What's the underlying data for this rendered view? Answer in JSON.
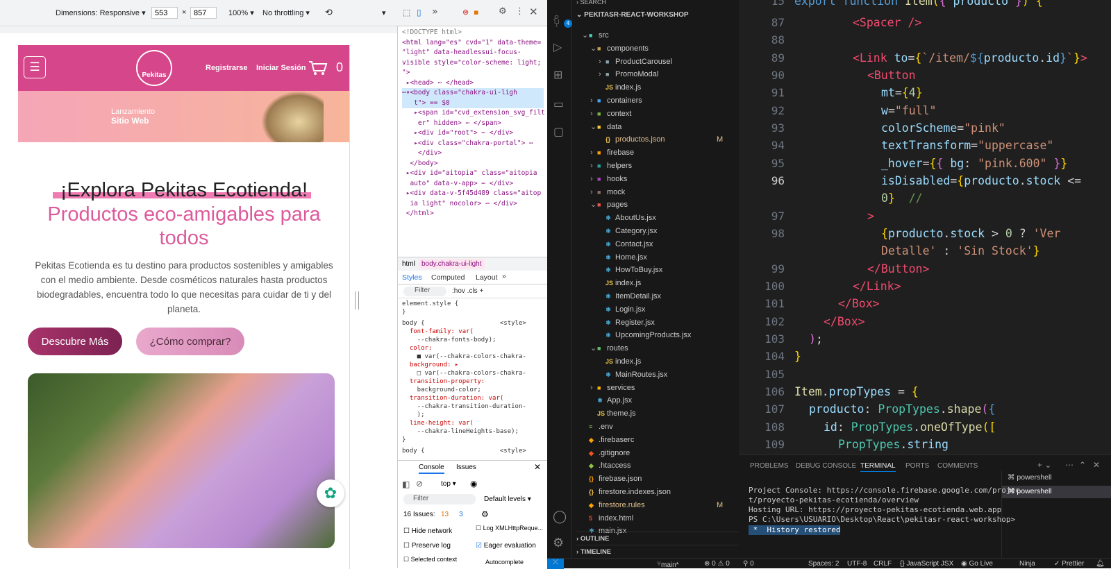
{
  "devtools_bar": {
    "dimensions_label": "Dimensions: Responsive ▾",
    "width": "553",
    "x": "×",
    "height": "857",
    "zoom": "100% ▾",
    "throttle": "No throttling ▾"
  },
  "site": {
    "nav": {
      "register": "Registrarse",
      "login": "Iniciar Sesión",
      "cart_count": "0",
      "logo_text": "Pekitas"
    },
    "banner": {
      "line1": "Lanzamiento",
      "line2": "Sitio Web"
    },
    "hero": {
      "title": "¡Explora Pekitas Ecotienda!",
      "subtitle": "Productos eco-amigables para todos",
      "description": "Pekitas Ecotienda es tu destino para productos sostenibles y amigables con el medio ambiente. Desde cosméticos naturales hasta productos biodegradables, encuentra todo lo que necesitas para cuidar de ti y del planeta.",
      "btn_primary": "Descubre Más",
      "btn_secondary": "¿Cómo comprar?"
    }
  },
  "devtools": {
    "dom_lines": [
      "<!DOCTYPE html>",
      "<html lang=\"es\" cvd=\"1\" data-theme=",
      "\"light\" data-headlessui-focus-",
      "visible style=\"color-scheme: light;",
      "\">",
      " ▸<head> ⋯ </head>",
      "⋯▾<body class=\"chakra-ui-ligh",
      "   t\"> == $0",
      "   ▸<span id=\"cvd_extension_svg_filt",
      "    er\" hidden> ⋯ </span>",
      "   ▸<div id=\"root\"> ⋯ </div>",
      "   ▸<div class=\"chakra-portal\"> ⋯ ",
      "    </div>",
      "  </body>",
      " ▸<div id=\"aitopia\" class=\"aitopia",
      "  auto\" data-v-app> ⋯ </div>",
      " ▸<div data-v-5f45d489 class=\"aitop",
      "  ia light\" nocolor> ⋯ </div>",
      " </html>"
    ],
    "crumbs": [
      "html",
      "body.chakra-ui-light"
    ],
    "style_tabs": [
      "Styles",
      "Computed",
      "Layout",
      "»"
    ],
    "filter_placeholder": "Filter",
    "filter_tools": ":hov  .cls  +",
    "style_lines": [
      "element.style {",
      "}",
      "body {                    <style>",
      "  font-family: var(",
      "    --chakra-fonts-body);",
      "  color:",
      "    ■ var(--chakra-colors-chakra-",
      "  background: ▸",
      "    □ var(--chakra-colors-chakra-",
      "  transition-property:",
      "    background-color;",
      "  transition-duration: var(",
      "    --chakra-transition-duration-",
      "    );",
      "  line-height: var(",
      "    --chakra-lineHeights-base);",
      "}",
      "body {                    <style>"
    ],
    "console": {
      "tabs": [
        "Console",
        "Issues"
      ],
      "context": "top ▾",
      "filter": "Filter",
      "levels": "Default levels ▾",
      "issues": "16 Issues:",
      "issues_warn": "13",
      "issues_info": "3",
      "opts": [
        "Hide network",
        "Log XMLHttpReque...",
        "Preserve log",
        "Eager evaluation",
        "Selected context",
        "Autocomplete"
      ]
    }
  },
  "vscode": {
    "search_header": "SEARCH",
    "project": "PEKITASR-REACT-WORKSHOP",
    "tree": [
      {
        "label": "src",
        "depth": 0,
        "type": "folder-open",
        "color": "#4ec9b0"
      },
      {
        "label": "components",
        "depth": 1,
        "type": "folder-open",
        "color": "#c5a24a"
      },
      {
        "label": "ProductCarousel",
        "depth": 2,
        "type": "folder",
        "color": "#90a4ae"
      },
      {
        "label": "PromoModal",
        "depth": 2,
        "type": "folder",
        "color": "#90a4ae"
      },
      {
        "label": "index.js",
        "depth": 2,
        "type": "js",
        "color": "#e8c547"
      },
      {
        "label": "containers",
        "depth": 1,
        "type": "folder",
        "color": "#42a5f5"
      },
      {
        "label": "context",
        "depth": 1,
        "type": "folder",
        "color": "#7cb342"
      },
      {
        "label": "data",
        "depth": 1,
        "type": "folder-open",
        "color": "#ffca28"
      },
      {
        "label": "productos.json",
        "depth": 2,
        "type": "json",
        "color": "#f5c451",
        "status": "M"
      },
      {
        "label": "firebase",
        "depth": 1,
        "type": "folder",
        "color": "#ffa000"
      },
      {
        "label": "helpers",
        "depth": 1,
        "type": "folder",
        "color": "#26a69a"
      },
      {
        "label": "hooks",
        "depth": 1,
        "type": "folder",
        "color": "#ab47bc"
      },
      {
        "label": "mock",
        "depth": 1,
        "type": "folder",
        "color": "#8d6e63"
      },
      {
        "label": "pages",
        "depth": 1,
        "type": "folder-open",
        "color": "#ef5350"
      },
      {
        "label": "AboutUs.jsx",
        "depth": 2,
        "type": "jsx",
        "color": "#4fc3f7"
      },
      {
        "label": "Category.jsx",
        "depth": 2,
        "type": "jsx",
        "color": "#4fc3f7"
      },
      {
        "label": "Contact.jsx",
        "depth": 2,
        "type": "jsx",
        "color": "#4fc3f7"
      },
      {
        "label": "Home.jsx",
        "depth": 2,
        "type": "jsx",
        "color": "#4fc3f7"
      },
      {
        "label": "HowToBuy.jsx",
        "depth": 2,
        "type": "jsx",
        "color": "#4fc3f7"
      },
      {
        "label": "index.js",
        "depth": 2,
        "type": "js",
        "color": "#e8c547"
      },
      {
        "label": "ItemDetail.jsx",
        "depth": 2,
        "type": "jsx",
        "color": "#4fc3f7"
      },
      {
        "label": "Login.jsx",
        "depth": 2,
        "type": "jsx",
        "color": "#4fc3f7"
      },
      {
        "label": "Register.jsx",
        "depth": 2,
        "type": "jsx",
        "color": "#4fc3f7"
      },
      {
        "label": "UpcomingProducts.jsx",
        "depth": 2,
        "type": "jsx",
        "color": "#4fc3f7"
      },
      {
        "label": "routes",
        "depth": 1,
        "type": "folder-open",
        "color": "#66bb6a"
      },
      {
        "label": "index.js",
        "depth": 2,
        "type": "js",
        "color": "#e8c547"
      },
      {
        "label": "MainRoutes.jsx",
        "depth": 2,
        "type": "jsx",
        "color": "#4fc3f7"
      },
      {
        "label": "services",
        "depth": 1,
        "type": "folder",
        "color": "#ffb300"
      },
      {
        "label": "App.jsx",
        "depth": 1,
        "type": "jsx",
        "color": "#4fc3f7"
      },
      {
        "label": "theme.js",
        "depth": 1,
        "type": "js",
        "color": "#e8c547"
      },
      {
        "label": ".env",
        "depth": 0,
        "type": "env",
        "color": "#8bc34a"
      },
      {
        "label": ".firebaserc",
        "depth": 0,
        "type": "file",
        "color": "#ffa000"
      },
      {
        "label": ".gitignore",
        "depth": 0,
        "type": "file",
        "color": "#f4511e"
      },
      {
        "label": ".htaccess",
        "depth": 0,
        "type": "file",
        "color": "#8bc34a"
      },
      {
        "label": "firebase.json",
        "depth": 0,
        "type": "json",
        "color": "#ffa000"
      },
      {
        "label": "firestore.indexes.json",
        "depth": 0,
        "type": "json",
        "color": "#f5c451"
      },
      {
        "label": "firestore.rules",
        "depth": 0,
        "type": "file",
        "color": "#ffa000",
        "status": "M"
      },
      {
        "label": "index.html",
        "depth": 0,
        "type": "html",
        "color": "#e44d26"
      },
      {
        "label": "main.jsx",
        "depth": 0,
        "type": "jsx",
        "color": "#4fc3f7"
      }
    ],
    "outline": "OUTLINE",
    "timeline": "TIMELINE",
    "line_numbers": [
      "15",
      "87",
      "88",
      "89",
      "90",
      "91",
      "92",
      "93",
      "94",
      "95",
      "96",
      "",
      "97",
      "98",
      "",
      "99",
      "100",
      "101",
      "102",
      "103",
      "104",
      "105",
      "106",
      "107",
      "108",
      "109"
    ],
    "panel_tabs": [
      "PROBLEMS",
      "DEBUG CONSOLE",
      "TERMINAL",
      "PORTS",
      "COMMENTS"
    ],
    "terminal": [
      "Project Console: https://console.firebase.google.com/projec",
      "t/proyecto-pekitas-ecotienda/overview",
      "Hosting URL: https://proyecto-pekitas-ecotienda.web.app",
      "PS C:\\Users\\USUARIO\\Desktop\\React\\pekitasr-react-workshop>"
    ],
    "history": " *  History restored",
    "shells": [
      "powershell",
      "powershell"
    ],
    "status": {
      "branch": "main*",
      "errors": "⊗ 0 ⚠ 0",
      "ports": "⚲ 0",
      "spaces": "Spaces: 2",
      "enc": "UTF-8",
      "eol": "CRLF",
      "lang": "{} JavaScript JSX",
      "live": "◉ Go Live",
      "ninja": "Ninja",
      "prettier": "✓ Prettier"
    }
  }
}
